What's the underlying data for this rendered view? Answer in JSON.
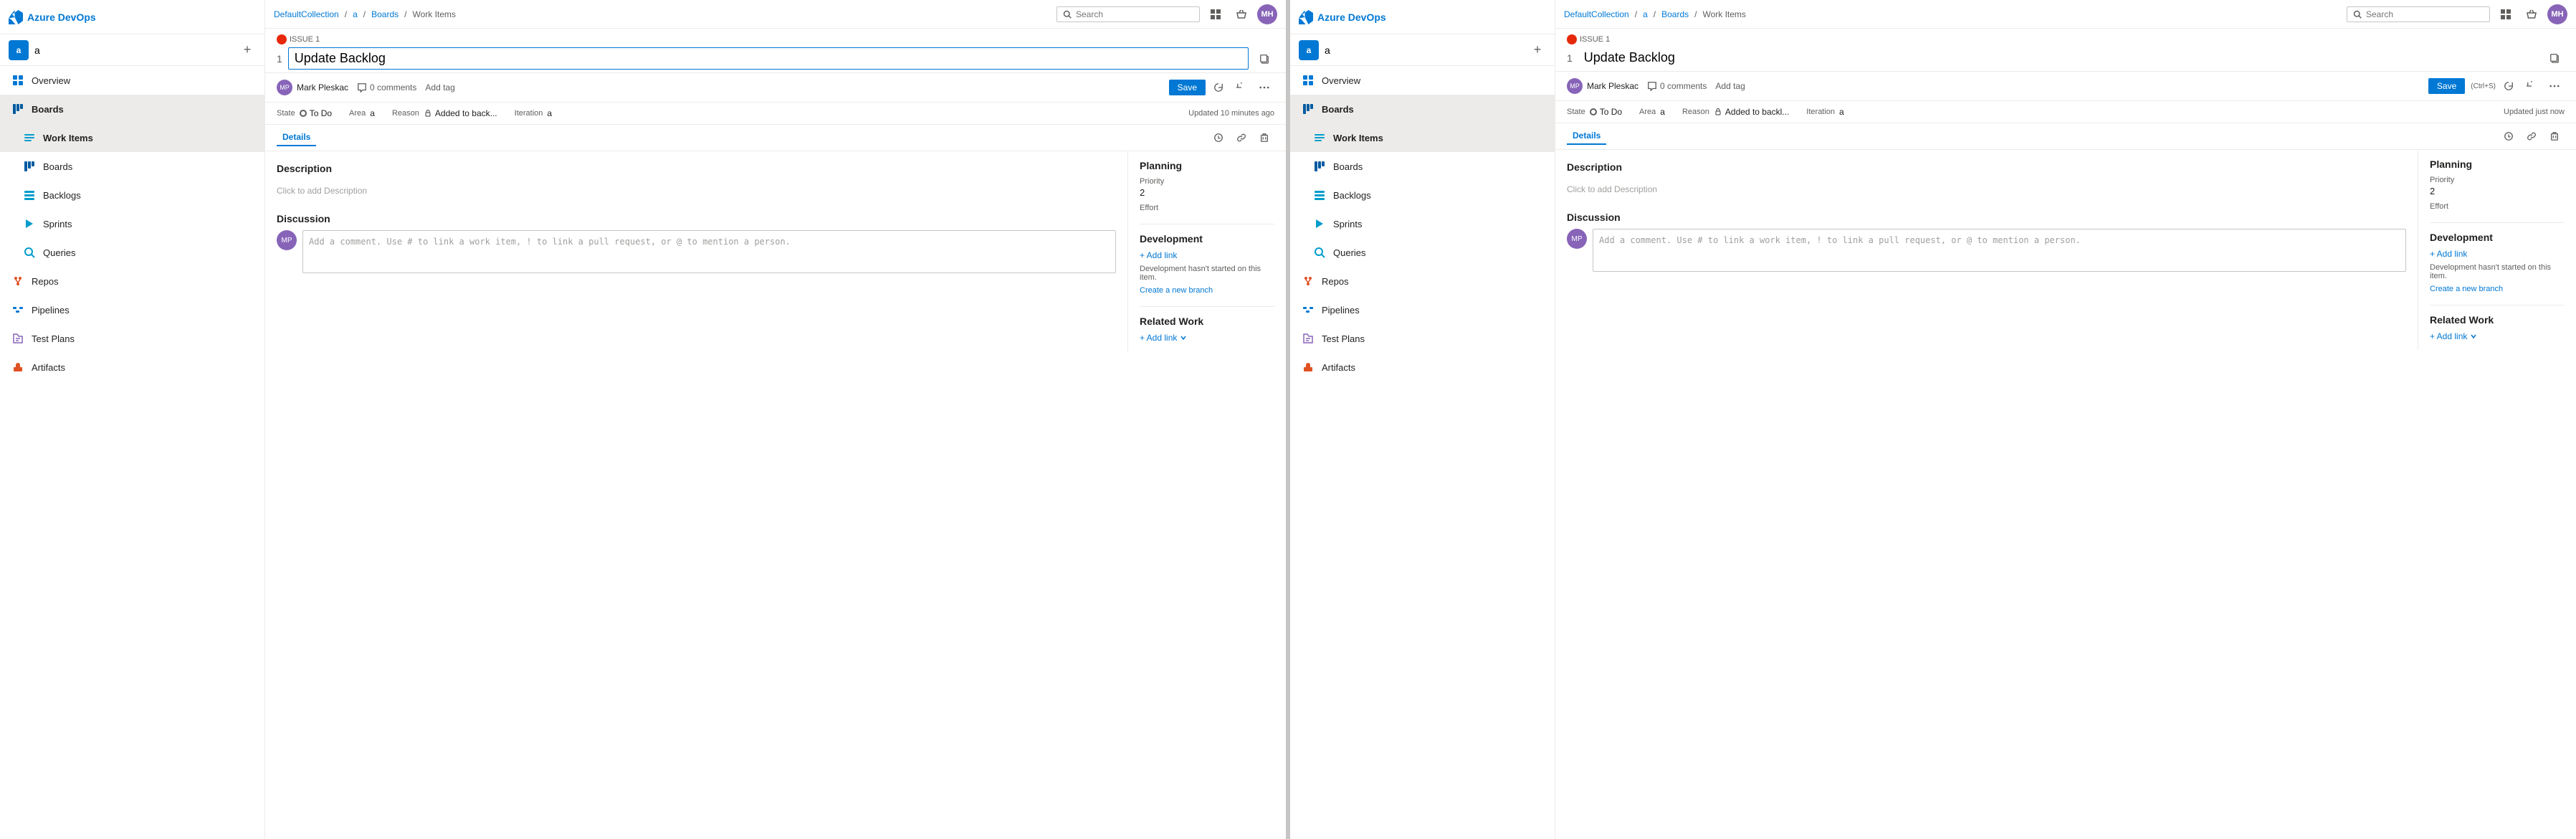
{
  "app": {
    "name": "Azure DevOps",
    "logo_text": "Azure DevOps"
  },
  "breadcrumb": {
    "collection": "DefaultCollection",
    "project": "a",
    "boards": "Boards",
    "work_items": "Work Items"
  },
  "search": {
    "placeholder": "Search"
  },
  "user": {
    "initials": "MH"
  },
  "sidebar_left": {
    "project": "a",
    "nav_items": [
      {
        "id": "overview",
        "label": "Overview",
        "icon": "overview"
      },
      {
        "id": "boards",
        "label": "Boards",
        "icon": "boards",
        "active": true
      },
      {
        "id": "work-items",
        "label": "Work Items",
        "icon": "work-items",
        "active": true,
        "sub": true
      },
      {
        "id": "boards-sub",
        "label": "Boards",
        "icon": "boards",
        "sub": true
      },
      {
        "id": "backlogs",
        "label": "Backlogs",
        "icon": "backlogs",
        "sub": true
      },
      {
        "id": "sprints",
        "label": "Sprints",
        "icon": "sprints",
        "sub": true
      },
      {
        "id": "queries",
        "label": "Queries",
        "icon": "queries",
        "sub": true
      },
      {
        "id": "repos",
        "label": "Repos",
        "icon": "repos"
      },
      {
        "id": "pipelines",
        "label": "Pipelines",
        "icon": "pipelines"
      },
      {
        "id": "test-plans",
        "label": "Test Plans",
        "icon": "test-plans"
      },
      {
        "id": "artifacts",
        "label": "Artifacts",
        "icon": "artifacts"
      }
    ]
  },
  "work_item_left": {
    "issue_label": "ISSUE 1",
    "issue_number": "1",
    "title": "Update Backlog",
    "assigned_to": "Mark Pleskac",
    "comments_count": "0 comments",
    "add_tag_label": "Add tag",
    "save_label": "Save",
    "state_label": "State",
    "state_value": "To Do",
    "area_label": "Area",
    "area_value": "a",
    "reason_label": "Reason",
    "reason_value": "Added to back...",
    "iteration_label": "Iteration",
    "iteration_value": "a",
    "updated_text": "Updated 10 minutes ago",
    "details_tab": "Details",
    "description_title": "Description",
    "description_placeholder": "Click to add Description",
    "discussion_title": "Discussion",
    "discussion_placeholder": "Add a comment. Use # to link a work item, ! to link a pull request, or @ to mention a person.",
    "planning_title": "Planning",
    "priority_label": "Priority",
    "priority_value": "2",
    "effort_label": "Effort",
    "effort_value": "",
    "development_title": "Development",
    "add_link_label": "+ Add link",
    "dev_note": "Development hasn't started on this item.",
    "create_branch_label": "Create a new branch",
    "related_work_title": "Related Work",
    "related_add_link_label": "+ Add link"
  },
  "work_item_right": {
    "issue_label": "ISSUE 1",
    "issue_number": "1",
    "title": "Update Backlog",
    "assigned_to": "Mark Pleskac",
    "comments_count": "0 comments",
    "add_tag_label": "Add tag",
    "save_label": "Save",
    "save_shortcut": "(Ctrl+S)",
    "state_label": "State",
    "state_value": "To Do",
    "area_label": "Area",
    "area_value": "a",
    "reason_label": "Reason",
    "reason_value": "Added to backl...",
    "iteration_label": "Iteration",
    "iteration_value": "a",
    "updated_text": "Updated just now",
    "details_tab": "Details",
    "description_title": "Description",
    "description_placeholder": "Click to add Description",
    "discussion_title": "Discussion",
    "discussion_placeholder": "Add a comment. Use # to link a work item, ! to link a pull request, or @ to mention a person.",
    "planning_title": "Planning",
    "priority_label": "Priority",
    "priority_value": "2",
    "effort_label": "Effort",
    "effort_value": "",
    "development_title": "Development",
    "add_link_label": "+ Add link",
    "dev_note": "Development hasn't started on this item.",
    "create_branch_label": "Create a new branch",
    "related_work_title": "Related Work",
    "related_add_link_label": "+ Add link"
  }
}
